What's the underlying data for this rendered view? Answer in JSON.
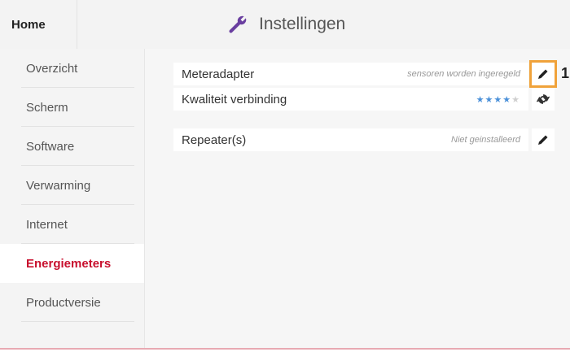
{
  "header": {
    "home_label": "Home",
    "title": "Instellingen",
    "title_icon": "wrench-icon"
  },
  "sidebar": {
    "items": [
      {
        "label": "Overzicht",
        "active": false
      },
      {
        "label": "Scherm",
        "active": false
      },
      {
        "label": "Software",
        "active": false
      },
      {
        "label": "Verwarming",
        "active": false
      },
      {
        "label": "Internet",
        "active": false
      },
      {
        "label": "Energiemeters",
        "active": true
      },
      {
        "label": "Productversie",
        "active": false
      }
    ]
  },
  "main": {
    "rows": [
      {
        "name": "Meteradapter",
        "status": "sensoren worden ingeregeld",
        "action_icon": "pencil-icon"
      },
      {
        "name": "Kwaliteit verbinding",
        "stars": 4,
        "stars_max": 5,
        "action_icon": "refresh-icon"
      },
      {
        "name": "Repeater(s)",
        "status": "Niet geinstalleerd",
        "action_icon": "pencil-icon"
      }
    ],
    "callout": "1"
  },
  "colors": {
    "accent": "#c8102e",
    "highlight": "#f0a23a",
    "stars_on": "#4a90d9"
  }
}
